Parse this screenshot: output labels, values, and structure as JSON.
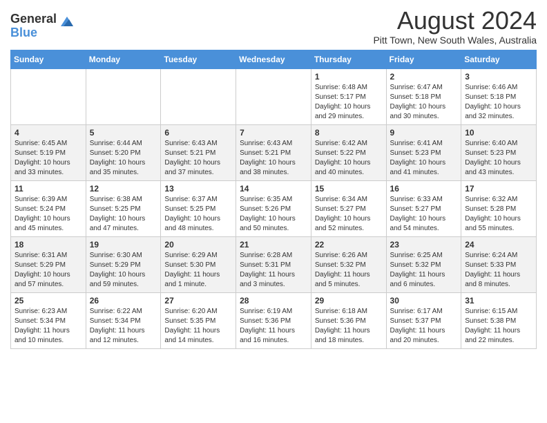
{
  "header": {
    "logo": {
      "general": "General",
      "blue": "Blue"
    },
    "title": "August 2024",
    "location": "Pitt Town, New South Wales, Australia"
  },
  "days_of_week": [
    "Sunday",
    "Monday",
    "Tuesday",
    "Wednesday",
    "Thursday",
    "Friday",
    "Saturday"
  ],
  "weeks": [
    [
      {
        "day": "",
        "info": ""
      },
      {
        "day": "",
        "info": ""
      },
      {
        "day": "",
        "info": ""
      },
      {
        "day": "",
        "info": ""
      },
      {
        "day": "1",
        "info": "Sunrise: 6:48 AM\nSunset: 5:17 PM\nDaylight: 10 hours and 29 minutes."
      },
      {
        "day": "2",
        "info": "Sunrise: 6:47 AM\nSunset: 5:18 PM\nDaylight: 10 hours and 30 minutes."
      },
      {
        "day": "3",
        "info": "Sunrise: 6:46 AM\nSunset: 5:18 PM\nDaylight: 10 hours and 32 minutes."
      }
    ],
    [
      {
        "day": "4",
        "info": "Sunrise: 6:45 AM\nSunset: 5:19 PM\nDaylight: 10 hours and 33 minutes."
      },
      {
        "day": "5",
        "info": "Sunrise: 6:44 AM\nSunset: 5:20 PM\nDaylight: 10 hours and 35 minutes."
      },
      {
        "day": "6",
        "info": "Sunrise: 6:43 AM\nSunset: 5:21 PM\nDaylight: 10 hours and 37 minutes."
      },
      {
        "day": "7",
        "info": "Sunrise: 6:43 AM\nSunset: 5:21 PM\nDaylight: 10 hours and 38 minutes."
      },
      {
        "day": "8",
        "info": "Sunrise: 6:42 AM\nSunset: 5:22 PM\nDaylight: 10 hours and 40 minutes."
      },
      {
        "day": "9",
        "info": "Sunrise: 6:41 AM\nSunset: 5:23 PM\nDaylight: 10 hours and 41 minutes."
      },
      {
        "day": "10",
        "info": "Sunrise: 6:40 AM\nSunset: 5:23 PM\nDaylight: 10 hours and 43 minutes."
      }
    ],
    [
      {
        "day": "11",
        "info": "Sunrise: 6:39 AM\nSunset: 5:24 PM\nDaylight: 10 hours and 45 minutes."
      },
      {
        "day": "12",
        "info": "Sunrise: 6:38 AM\nSunset: 5:25 PM\nDaylight: 10 hours and 47 minutes."
      },
      {
        "day": "13",
        "info": "Sunrise: 6:37 AM\nSunset: 5:25 PM\nDaylight: 10 hours and 48 minutes."
      },
      {
        "day": "14",
        "info": "Sunrise: 6:35 AM\nSunset: 5:26 PM\nDaylight: 10 hours and 50 minutes."
      },
      {
        "day": "15",
        "info": "Sunrise: 6:34 AM\nSunset: 5:27 PM\nDaylight: 10 hours and 52 minutes."
      },
      {
        "day": "16",
        "info": "Sunrise: 6:33 AM\nSunset: 5:27 PM\nDaylight: 10 hours and 54 minutes."
      },
      {
        "day": "17",
        "info": "Sunrise: 6:32 AM\nSunset: 5:28 PM\nDaylight: 10 hours and 55 minutes."
      }
    ],
    [
      {
        "day": "18",
        "info": "Sunrise: 6:31 AM\nSunset: 5:29 PM\nDaylight: 10 hours and 57 minutes."
      },
      {
        "day": "19",
        "info": "Sunrise: 6:30 AM\nSunset: 5:29 PM\nDaylight: 10 hours and 59 minutes."
      },
      {
        "day": "20",
        "info": "Sunrise: 6:29 AM\nSunset: 5:30 PM\nDaylight: 11 hours and 1 minute."
      },
      {
        "day": "21",
        "info": "Sunrise: 6:28 AM\nSunset: 5:31 PM\nDaylight: 11 hours and 3 minutes."
      },
      {
        "day": "22",
        "info": "Sunrise: 6:26 AM\nSunset: 5:32 PM\nDaylight: 11 hours and 5 minutes."
      },
      {
        "day": "23",
        "info": "Sunrise: 6:25 AM\nSunset: 5:32 PM\nDaylight: 11 hours and 6 minutes."
      },
      {
        "day": "24",
        "info": "Sunrise: 6:24 AM\nSunset: 5:33 PM\nDaylight: 11 hours and 8 minutes."
      }
    ],
    [
      {
        "day": "25",
        "info": "Sunrise: 6:23 AM\nSunset: 5:34 PM\nDaylight: 11 hours and 10 minutes."
      },
      {
        "day": "26",
        "info": "Sunrise: 6:22 AM\nSunset: 5:34 PM\nDaylight: 11 hours and 12 minutes."
      },
      {
        "day": "27",
        "info": "Sunrise: 6:20 AM\nSunset: 5:35 PM\nDaylight: 11 hours and 14 minutes."
      },
      {
        "day": "28",
        "info": "Sunrise: 6:19 AM\nSunset: 5:36 PM\nDaylight: 11 hours and 16 minutes."
      },
      {
        "day": "29",
        "info": "Sunrise: 6:18 AM\nSunset: 5:36 PM\nDaylight: 11 hours and 18 minutes."
      },
      {
        "day": "30",
        "info": "Sunrise: 6:17 AM\nSunset: 5:37 PM\nDaylight: 11 hours and 20 minutes."
      },
      {
        "day": "31",
        "info": "Sunrise: 6:15 AM\nSunset: 5:38 PM\nDaylight: 11 hours and 22 minutes."
      }
    ]
  ]
}
